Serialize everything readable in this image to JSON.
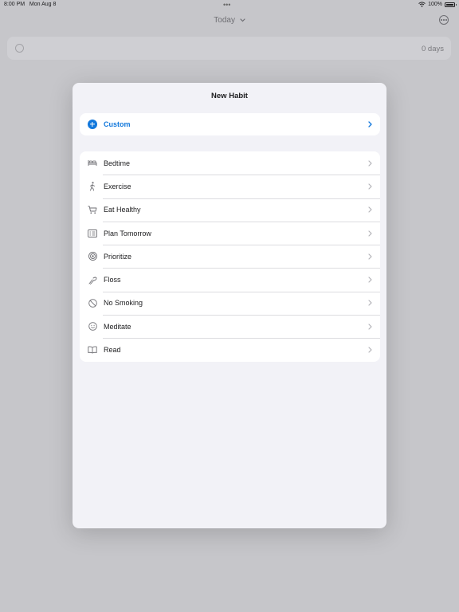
{
  "status_bar": {
    "time": "8:00 PM",
    "date": "Mon Aug 8",
    "battery": "100%"
  },
  "nav": {
    "title": "Today"
  },
  "background_row": {
    "days": "0 days"
  },
  "modal": {
    "title": "New Habit",
    "custom_label": "Custom",
    "templates": [
      {
        "label": "Bedtime",
        "icon": "bed-icon"
      },
      {
        "label": "Exercise",
        "icon": "walking-icon"
      },
      {
        "label": "Eat Healthy",
        "icon": "cart-icon"
      },
      {
        "label": "Plan Tomorrow",
        "icon": "list-icon"
      },
      {
        "label": "Prioritize",
        "icon": "target-icon"
      },
      {
        "label": "Floss",
        "icon": "floss-icon"
      },
      {
        "label": "No Smoking",
        "icon": "prohibited-icon"
      },
      {
        "label": "Meditate",
        "icon": "smiley-icon"
      },
      {
        "label": "Read",
        "icon": "book-icon"
      }
    ]
  },
  "colors": {
    "accent": "#1278dc",
    "icon": "#6e6e73",
    "chevron": "#b4b4b9"
  }
}
